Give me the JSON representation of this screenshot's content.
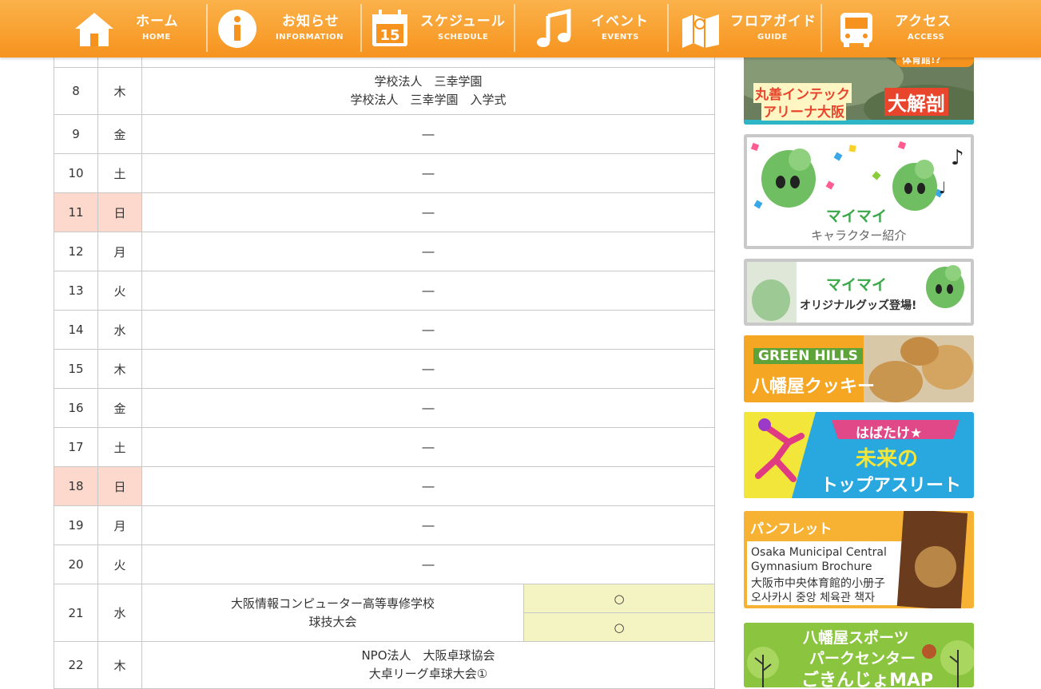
{
  "nav": [
    {
      "jp": "ホーム",
      "en": "HOME",
      "icon": "house-icon"
    },
    {
      "jp": "お知らせ",
      "en": "INFORMATION",
      "icon": "info-icon"
    },
    {
      "jp": "スケジュール",
      "en": "SCHEDULE",
      "icon": "calendar-icon",
      "icon_text": "15"
    },
    {
      "jp": "イベント",
      "en": "EVENTS",
      "icon": "music-note-icon"
    },
    {
      "jp": "フロアガイド",
      "en": "GUIDE",
      "icon": "map-icon"
    },
    {
      "jp": "アクセス",
      "en": "ACCESS",
      "icon": "bus-icon"
    }
  ],
  "schedule": {
    "rows": [
      {
        "day": "8",
        "weekday": "木",
        "events": [
          "学校法人　三幸学園",
          "学校法人　三幸学園　入学式"
        ]
      },
      {
        "day": "9",
        "weekday": "金",
        "events": [
          "―"
        ]
      },
      {
        "day": "10",
        "weekday": "土",
        "events": [
          "―"
        ]
      },
      {
        "day": "11",
        "weekday": "日",
        "events": [
          "―"
        ],
        "sunday": true
      },
      {
        "day": "12",
        "weekday": "月",
        "events": [
          "―"
        ]
      },
      {
        "day": "13",
        "weekday": "火",
        "events": [
          "―"
        ]
      },
      {
        "day": "14",
        "weekday": "水",
        "events": [
          "―"
        ]
      },
      {
        "day": "15",
        "weekday": "木",
        "events": [
          "―"
        ]
      },
      {
        "day": "16",
        "weekday": "金",
        "events": [
          "―"
        ]
      },
      {
        "day": "17",
        "weekday": "土",
        "events": [
          "―"
        ]
      },
      {
        "day": "18",
        "weekday": "日",
        "events": [
          "―"
        ],
        "sunday": true
      },
      {
        "day": "19",
        "weekday": "月",
        "events": [
          "―"
        ]
      },
      {
        "day": "20",
        "weekday": "火",
        "events": [
          "―"
        ]
      },
      {
        "day": "21",
        "weekday": "水",
        "events": [
          "大阪情報コンピューター高等専修学校",
          "球技大会"
        ],
        "marks": [
          "○",
          "○"
        ]
      },
      {
        "day": "22",
        "weekday": "木",
        "events": [
          "NPO法人　大阪卓球協会",
          "大卓リーグ卓球大会①"
        ]
      }
    ]
  },
  "sidebar": {
    "banner1": {
      "line1": "丸善インテック",
      "line2": "アリーナ大阪",
      "badge": "大解剖",
      "top": "体育館!?"
    },
    "banner2": {
      "title": "マイマイ",
      "sub": "キャラクター紹介"
    },
    "banner3": {
      "title": "マイマイ",
      "sub": "オリジナルグッズ登場!"
    },
    "banner4": {
      "label": "GREEN HILLS",
      "title": "八幡屋クッキー"
    },
    "banner5": {
      "ribbon": "はばたけ★",
      "title": "未来の",
      "title2": "トップアスリート"
    },
    "banner6": {
      "label": "パンフレット",
      "l1": "Osaka Municipal Central",
      "l2": "Gymnasium Brochure",
      "l3": "大阪市中央体育館的小册子",
      "l4": "오사카시 중앙 체육관 책자"
    },
    "banner7": {
      "l1": "八幡屋スポーツ",
      "l2": "パークセンター",
      "l3": "ごきんじょMAP"
    }
  },
  "colors": {
    "nav": "#f6931e",
    "sunday": "#fcd8cd",
    "available": "#f4f4c3",
    "border": "#c8c8c8"
  }
}
